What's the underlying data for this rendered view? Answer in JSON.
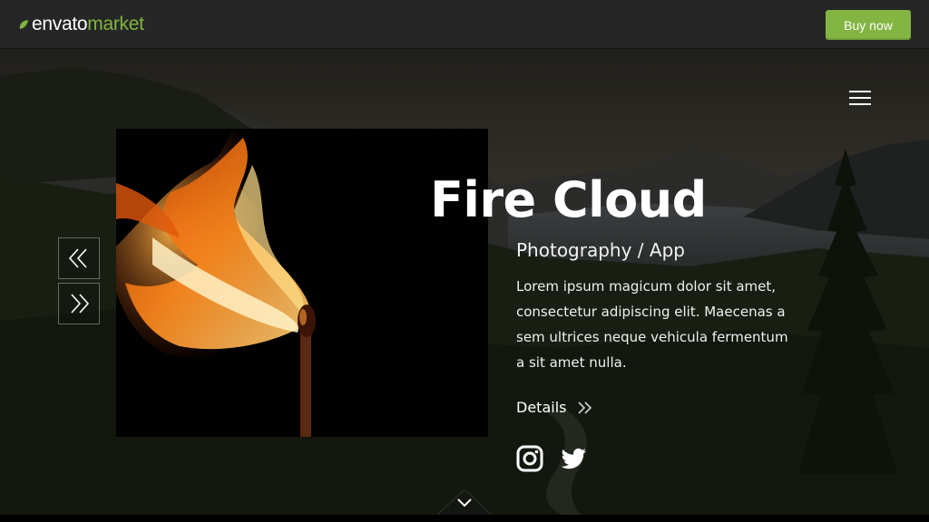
{
  "header": {
    "logo_envato": "envato",
    "logo_market": "market",
    "buy_label": "Buy now",
    "accent_color": "#82b541"
  },
  "slide": {
    "title": "Fire Cloud",
    "subtitle": "Photography / App",
    "description": "Lorem ipsum magicum dolor sit amet, consectetur adipiscing elit. Maecenas a sem ultrices neque vehicula fermentum a sit amet nulla.",
    "details_label": "Details"
  },
  "icons": {
    "menu": "hamburger-menu-icon",
    "prev": "double-chevron-left-icon",
    "next": "double-chevron-right-icon",
    "details_arrow": "double-chevron-right-icon",
    "instagram": "instagram-icon",
    "twitter": "twitter-icon",
    "scroll_down": "chevron-down-icon"
  }
}
